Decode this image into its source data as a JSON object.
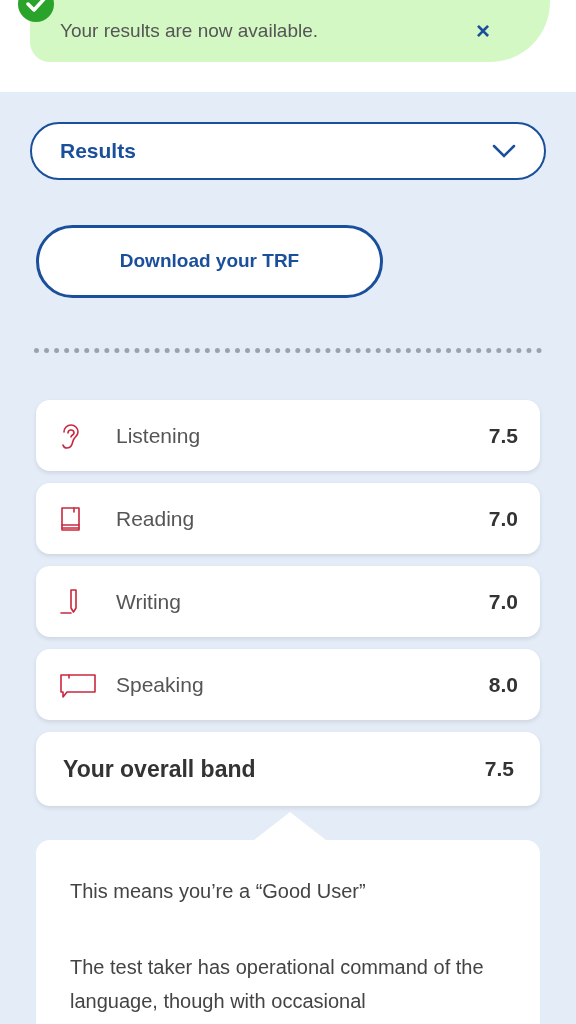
{
  "notification": {
    "message": "Your results are now available.",
    "close": "×"
  },
  "section_select": {
    "value": "Results"
  },
  "download_button": {
    "label": "Download your TRF"
  },
  "scores": [
    {
      "kind": "ear",
      "label": "Listening",
      "score": "7.5"
    },
    {
      "kind": "book",
      "label": "Reading",
      "score": "7.0"
    },
    {
      "kind": "pen",
      "label": "Writing",
      "score": "7.0"
    },
    {
      "kind": "speech",
      "label": "Speaking",
      "score": "8.0"
    }
  ],
  "overall": {
    "label": "Your overall band",
    "score": "7.5"
  },
  "explanation": {
    "heading": "This means you’re a “Good User”",
    "body": "The test taker has operational command of the language, though with occasional"
  }
}
